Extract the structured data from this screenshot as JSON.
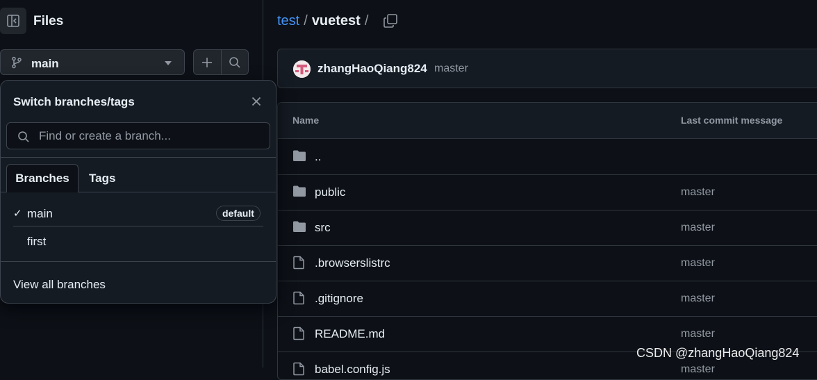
{
  "sidebar": {
    "title": "Files",
    "branch_button_label": "main",
    "add_file_icon": "plus-icon",
    "search_icon": "search-icon"
  },
  "dropdown": {
    "title": "Switch branches/tags",
    "search_placeholder": "Find or create a branch...",
    "tabs": [
      "Branches",
      "Tags"
    ],
    "branches": [
      {
        "name": "main",
        "checked": true,
        "badge": "default"
      },
      {
        "name": "first",
        "checked": false,
        "badge": ""
      }
    ],
    "check_mark": "✓",
    "view_all_label": "View all branches"
  },
  "breadcrumb": {
    "repo": "test",
    "separator": "/",
    "folder": "vuetest",
    "trailing_sep": "/"
  },
  "commit": {
    "user": "zhangHaoQiang824",
    "branch": "master"
  },
  "table": {
    "headers": {
      "name": "Name",
      "message": "Last commit message"
    },
    "rows": [
      {
        "type": "folder",
        "name": "..",
        "message": ""
      },
      {
        "type": "folder",
        "name": "public",
        "message": "master"
      },
      {
        "type": "folder",
        "name": "src",
        "message": "master"
      },
      {
        "type": "file",
        "name": ".browserslistrc",
        "message": "master"
      },
      {
        "type": "file",
        "name": ".gitignore",
        "message": "master"
      },
      {
        "type": "file",
        "name": "README.md",
        "message": "master"
      },
      {
        "type": "file",
        "name": "babel.config.js",
        "message": "master"
      }
    ]
  },
  "watermark": "CSDN @zhangHaoQiang824",
  "colors": {
    "background": "#0d1117",
    "accent_link": "#4493f8",
    "border": "#30363d",
    "muted_text": "#9198a1"
  }
}
